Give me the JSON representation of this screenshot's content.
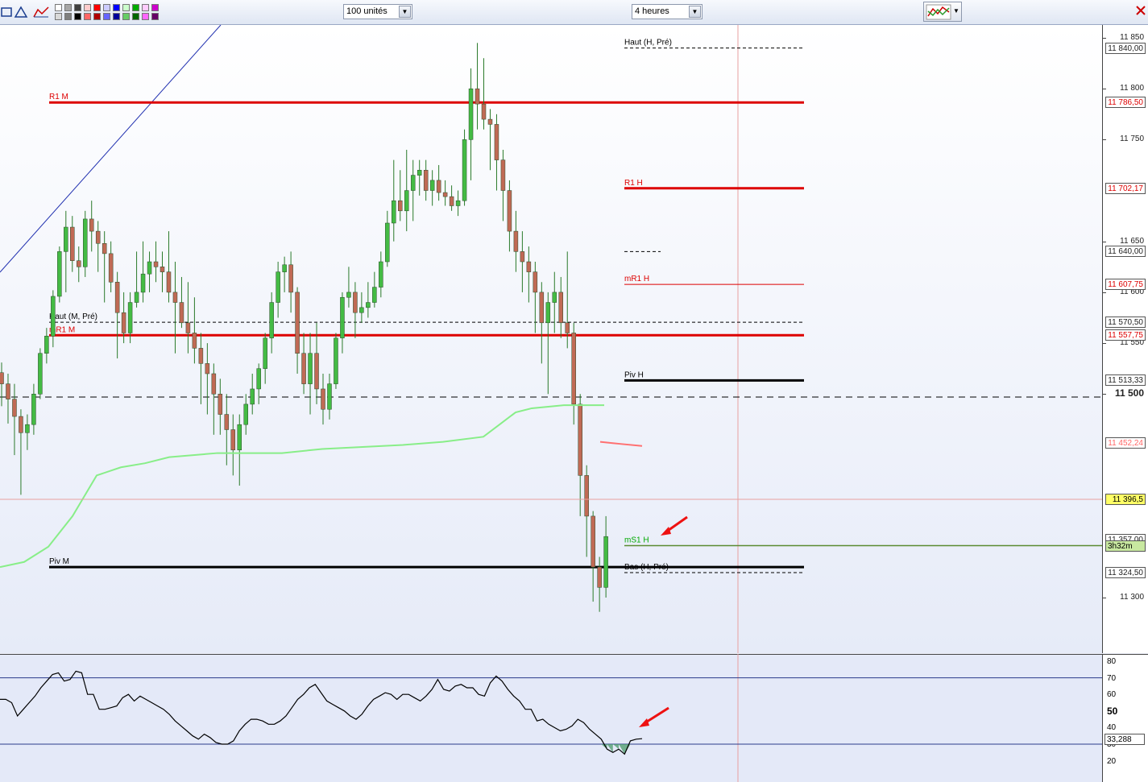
{
  "toolbar": {
    "units_select": "100 unités",
    "timeframe_select": "4 heures",
    "swatch_colors": [
      "#ffffff",
      "#d9d9d9",
      "#a6a6a6",
      "#7f7f7f",
      "#404040",
      "#000000",
      "#ffcccc",
      "#ff6666",
      "#ff0000",
      "#b00000",
      "#ccccff",
      "#6666ff",
      "#0000ff",
      "#000099",
      "#ccffcc",
      "#66cc66",
      "#00aa00",
      "#006600",
      "#ffccff",
      "#ff66ff",
      "#cc00cc",
      "#660066"
    ]
  },
  "price_axis": {
    "ticks": [
      "11 850",
      "11 800",
      "11 750",
      "11 650",
      "11 600",
      "11 550",
      "11 500",
      "11 300"
    ],
    "tick_values": [
      11850,
      11800,
      11750,
      11650,
      11600,
      11550,
      11500,
      11300
    ],
    "markers": [
      {
        "label": "11 840,00",
        "value": 11840.0,
        "color": "#222222"
      },
      {
        "label": "11 786,50",
        "value": 11786.5,
        "color": "#dd0000"
      },
      {
        "label": "11 702,17",
        "value": 11702.17,
        "color": "#dd0000"
      },
      {
        "label": "11 640,00",
        "value": 11640.0,
        "color": "#222222"
      },
      {
        "label": "11 607,75",
        "value": 11607.75,
        "color": "#dd0000"
      },
      {
        "label": "11 570,50",
        "value": 11570.5,
        "color": "#222222"
      },
      {
        "label": "11 557,75",
        "value": 11557.75,
        "color": "#dd0000"
      },
      {
        "label": "11 513,33",
        "value": 11513.33,
        "color": "#222222"
      },
      {
        "label": "11 452,24",
        "value": 11452.24,
        "color": "#ff6666"
      },
      {
        "label": "11 396,5",
        "value": 11396.5,
        "color": "#222222"
      },
      {
        "label": "11 357,00",
        "value": 11357.0,
        "color": "#222222"
      },
      {
        "label": "11 324,50",
        "value": 11324.5,
        "color": "#222222"
      }
    ],
    "countdown": "3h32m"
  },
  "levels": [
    {
      "label": "Haut (H, Pré)",
      "value": 11840.0,
      "color": "#000000",
      "style": "dashed",
      "scope": "H"
    },
    {
      "label": "R1 M",
      "value": 11786.5,
      "color": "#dd0000",
      "style": "thick",
      "scope": "M"
    },
    {
      "label": "R1 H",
      "value": 11702.17,
      "color": "#dd0000",
      "style": "thick",
      "scope": "H"
    },
    {
      "label": "mR1 H",
      "value": 11607.75,
      "color": "#dd0000",
      "style": "thin",
      "scope": "H"
    },
    {
      "label": "Haut (M, Pré)",
      "value": 11570.5,
      "color": "#000000",
      "style": "dashed",
      "scope": "M"
    },
    {
      "label": "mR1 M",
      "value": 11557.75,
      "color": "#dd0000",
      "style": "thick",
      "scope": "M"
    },
    {
      "label": "Piv H",
      "value": 11513.33,
      "color": "#000000",
      "style": "thick",
      "scope": "H"
    },
    {
      "label": "mS1 H",
      "value": 11351.0,
      "color": "#00aa00",
      "style": "thin",
      "scope": "H"
    },
    {
      "label": "Piv M",
      "value": 11330.0,
      "color": "#000000",
      "style": "thick",
      "scope": "M"
    },
    {
      "label": "Bas (H, Pré)",
      "value": 11324.5,
      "color": "#000000",
      "style": "dashed",
      "scope": "H"
    }
  ],
  "rsi": {
    "ticks": [
      "80",
      "70",
      "60",
      "50",
      "40",
      "30",
      "20"
    ],
    "tick_values": [
      80,
      70,
      60,
      50,
      40,
      30,
      20
    ],
    "current_label": "33,288",
    "current_value": 33.288,
    "overbought": 70,
    "oversold": 30,
    "values": [
      57,
      57,
      55,
      47,
      51,
      55,
      59,
      64,
      68,
      72,
      73,
      68,
      69,
      74,
      73,
      60,
      60,
      51,
      51,
      52,
      53,
      58,
      60,
      56,
      59,
      57,
      55,
      53,
      51,
      48,
      44,
      41,
      38,
      35,
      33,
      36,
      34,
      31,
      30,
      30,
      32,
      38,
      42,
      45,
      45,
      44,
      42,
      42,
      44,
      47,
      52,
      57,
      60,
      64,
      66,
      61,
      56,
      54,
      52,
      50,
      47,
      45,
      48,
      53,
      57,
      59,
      61,
      60,
      57,
      60,
      60,
      58,
      56,
      59,
      63,
      69,
      63,
      62,
      65,
      66,
      64,
      64,
      60,
      59,
      67,
      71,
      68,
      63,
      59,
      56,
      51,
      51,
      44,
      45,
      42,
      40,
      38,
      39,
      41,
      45,
      43,
      39,
      36,
      33,
      27,
      25,
      27,
      24,
      32,
      33,
      33.288
    ]
  },
  "chart_data": {
    "type": "candlestick",
    "instrument_timeframe": "4 heures",
    "ylim": [
      11267,
      11875
    ],
    "ohlc": [
      [
        11521,
        11531,
        11488,
        11510
      ],
      [
        11510,
        11520,
        11471,
        11495
      ],
      [
        11495,
        11510,
        11440,
        11478
      ],
      [
        11478,
        11485,
        11401,
        11462
      ],
      [
        11462,
        11480,
        11445,
        11470
      ],
      [
        11470,
        11510,
        11460,
        11500
      ],
      [
        11500,
        11545,
        11495,
        11540
      ],
      [
        11540,
        11565,
        11530,
        11557
      ],
      [
        11557,
        11602,
        11546,
        11596
      ],
      [
        11596,
        11645,
        11590,
        11640
      ],
      [
        11640,
        11680,
        11600,
        11664
      ],
      [
        11664,
        11675,
        11620,
        11631
      ],
      [
        11631,
        11645,
        11610,
        11625
      ],
      [
        11625,
        11680,
        11615,
        11672
      ],
      [
        11672,
        11690,
        11640,
        11660
      ],
      [
        11660,
        11670,
        11620,
        11648
      ],
      [
        11648,
        11660,
        11590,
        11638
      ],
      [
        11638,
        11650,
        11600,
        11610
      ],
      [
        11610,
        11620,
        11535,
        11580
      ],
      [
        11580,
        11600,
        11550,
        11560
      ],
      [
        11560,
        11600,
        11550,
        11590
      ],
      [
        11590,
        11640,
        11585,
        11600
      ],
      [
        11600,
        11650,
        11590,
        11618
      ],
      [
        11618,
        11640,
        11600,
        11630
      ],
      [
        11630,
        11650,
        11610,
        11625
      ],
      [
        11625,
        11640,
        11600,
        11620
      ],
      [
        11620,
        11660,
        11590,
        11600
      ],
      [
        11600,
        11630,
        11540,
        11590
      ],
      [
        11590,
        11615,
        11565,
        11570
      ],
      [
        11570,
        11610,
        11540,
        11560
      ],
      [
        11560,
        11595,
        11530,
        11545
      ],
      [
        11545,
        11560,
        11490,
        11530
      ],
      [
        11530,
        11550,
        11480,
        11520
      ],
      [
        11520,
        11530,
        11460,
        11500
      ],
      [
        11500,
        11515,
        11460,
        11480
      ],
      [
        11480,
        11500,
        11430,
        11465
      ],
      [
        11465,
        11480,
        11420,
        11445
      ],
      [
        11445,
        11480,
        11410,
        11470
      ],
      [
        11470,
        11500,
        11460,
        11490
      ],
      [
        11490,
        11520,
        11480,
        11505
      ],
      [
        11505,
        11530,
        11490,
        11525
      ],
      [
        11525,
        11560,
        11510,
        11555
      ],
      [
        11555,
        11600,
        11540,
        11590
      ],
      [
        11590,
        11630,
        11575,
        11620
      ],
      [
        11620,
        11635,
        11600,
        11627
      ],
      [
        11627,
        11640,
        11580,
        11600
      ],
      [
        11600,
        11605,
        11520,
        11540
      ],
      [
        11540,
        11560,
        11500,
        11510
      ],
      [
        11510,
        11560,
        11480,
        11540
      ],
      [
        11540,
        11570,
        11490,
        11505
      ],
      [
        11505,
        11520,
        11470,
        11485
      ],
      [
        11485,
        11520,
        11475,
        11510
      ],
      [
        11510,
        11560,
        11505,
        11555
      ],
      [
        11555,
        11600,
        11540,
        11595
      ],
      [
        11595,
        11625,
        11585,
        11600
      ],
      [
        11600,
        11610,
        11555,
        11580
      ],
      [
        11580,
        11600,
        11570,
        11585
      ],
      [
        11585,
        11610,
        11575,
        11590
      ],
      [
        11590,
        11620,
        11585,
        11605
      ],
      [
        11605,
        11640,
        11595,
        11630
      ],
      [
        11630,
        11680,
        11625,
        11668
      ],
      [
        11668,
        11730,
        11650,
        11690
      ],
      [
        11690,
        11720,
        11670,
        11680
      ],
      [
        11680,
        11740,
        11660,
        11700
      ],
      [
        11700,
        11730,
        11670,
        11715
      ],
      [
        11715,
        11730,
        11695,
        11720
      ],
      [
        11720,
        11730,
        11690,
        11700
      ],
      [
        11700,
        11720,
        11685,
        11710
      ],
      [
        11710,
        11725,
        11690,
        11698
      ],
      [
        11698,
        11710,
        11685,
        11694
      ],
      [
        11694,
        11705,
        11680,
        11685
      ],
      [
        11685,
        11700,
        11675,
        11690
      ],
      [
        11690,
        11760,
        11685,
        11750
      ],
      [
        11750,
        11820,
        11710,
        11800
      ],
      [
        11800,
        11845,
        11760,
        11785
      ],
      [
        11785,
        11830,
        11760,
        11770
      ],
      [
        11770,
        11780,
        11720,
        11765
      ],
      [
        11765,
        11775,
        11700,
        11730
      ],
      [
        11730,
        11740,
        11670,
        11700
      ],
      [
        11700,
        11710,
        11640,
        11660
      ],
      [
        11660,
        11680,
        11620,
        11640
      ],
      [
        11640,
        11660,
        11600,
        11630
      ],
      [
        11630,
        11645,
        11590,
        11620
      ],
      [
        11620,
        11630,
        11560,
        11600
      ],
      [
        11600,
        11610,
        11530,
        11570
      ],
      [
        11570,
        11600,
        11500,
        11590
      ],
      [
        11590,
        11620,
        11560,
        11600
      ],
      [
        11600,
        11615,
        11555,
        11570
      ],
      [
        11570,
        11640,
        11545,
        11560
      ],
      [
        11560,
        11570,
        11470,
        11490
      ],
      [
        11490,
        11500,
        11380,
        11420
      ],
      [
        11420,
        11430,
        11340,
        11380
      ],
      [
        11380,
        11385,
        11296,
        11330
      ],
      [
        11330,
        11340,
        11286,
        11310
      ],
      [
        11310,
        11380,
        11300,
        11360
      ]
    ],
    "moving_average": [
      [
        0,
        11330
      ],
      [
        30,
        11335
      ],
      [
        60,
        11350
      ],
      [
        90,
        11380
      ],
      [
        120,
        11420
      ],
      [
        150,
        11428
      ],
      [
        180,
        11432
      ],
      [
        210,
        11438
      ],
      [
        240,
        11440
      ],
      [
        270,
        11442
      ],
      [
        300,
        11442
      ],
      [
        330,
        11442
      ],
      [
        350,
        11442
      ],
      [
        400,
        11446
      ],
      [
        450,
        11448
      ],
      [
        500,
        11450
      ],
      [
        550,
        11453
      ],
      [
        600,
        11458
      ],
      [
        620,
        11470
      ],
      [
        640,
        11482
      ],
      [
        660,
        11486
      ],
      [
        700,
        11489
      ],
      [
        750,
        11489
      ]
    ],
    "moving_average_recent": [
      [
        745,
        11453
      ],
      [
        770,
        11451
      ],
      [
        797,
        11449
      ]
    ]
  },
  "annotations": {
    "arrows": 2
  }
}
